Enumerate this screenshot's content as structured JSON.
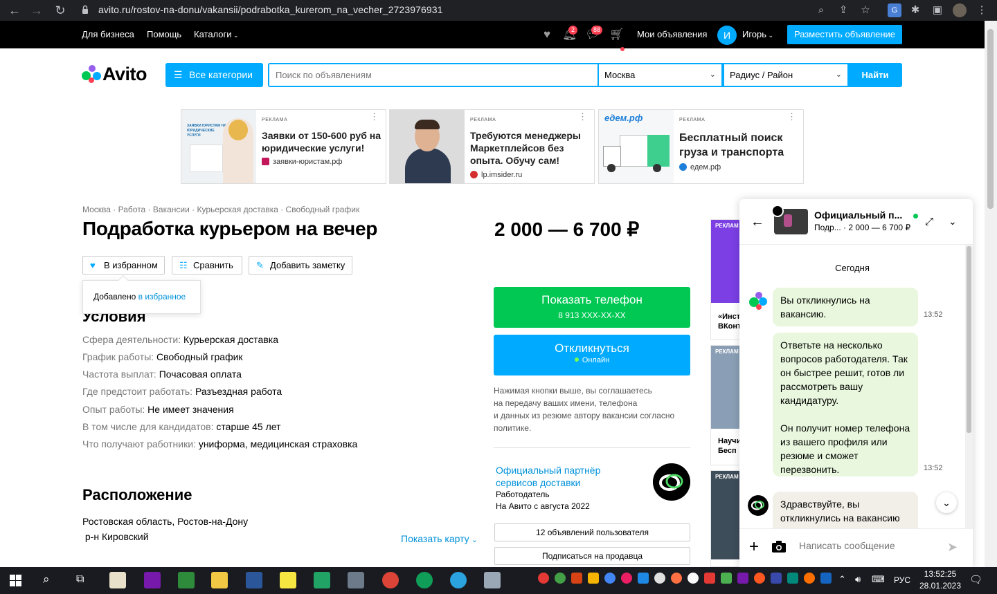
{
  "browser": {
    "url": "avito.ru/rostov-na-donu/vakansii/podrabotka_kurerom_na_vecher_2723976931"
  },
  "topbar": {
    "for_business": "Для бизнеса",
    "help": "Помощь",
    "catalogs": "Каталоги",
    "notifications_count": "2",
    "messages_count": "88",
    "my_ads": "Мои объявления",
    "avatar_letter": "И",
    "user_name": "Игорь",
    "post_ad": "Разместить объявление"
  },
  "search": {
    "logo": "Avito",
    "all_categories": "Все категории",
    "placeholder": "Поиск по объявлениям",
    "city": "Москва",
    "radius": "Радиус / Район",
    "find": "Найти"
  },
  "ads": [
    {
      "tag": "РЕКЛАМА",
      "title": "Заявки от 150-600 руб на юридические услуги!",
      "source": "заявки-юристам.рф"
    },
    {
      "tag": "РЕКЛАМА",
      "title": "Требуются менеджеры Маркетплейсов без опыта. Обучу сам!",
      "source": "lp.imsider.ru"
    },
    {
      "tag": "РЕКЛАМА",
      "title": "Бесплатный поиск груза и транспорта",
      "source": "едем.рф",
      "image_text": "едем.рф"
    }
  ],
  "ad_image_text": {
    "lawyers": "ЗАЯВКИ ЮРИСТАМ НА ЮРИДИЧЕСКИЕ УСЛУГИ"
  },
  "listing": {
    "breadcrumbs": "Москва · Работа · Вакансии · Курьерская доставка · Свободный график",
    "title": "Подработка курьером на вечер",
    "price": "2 000 — 6 700 ₽",
    "favorite": "В избранном",
    "compare": "Сравнить",
    "add_note": "Добавить заметку",
    "tooltip_prefix": "Добавлено ",
    "tooltip_link": "в избранное",
    "conditions_heading": "Условия",
    "conditions": [
      {
        "key": "Сфера деятельности: ",
        "value": "Курьерская доставка"
      },
      {
        "key": "График работы: ",
        "value": "Свободный график"
      },
      {
        "key": "Частота выплат: ",
        "value": "Почасовая оплата"
      },
      {
        "key": "Где предстоит работать: ",
        "value": "Разъездная работа"
      },
      {
        "key": "Опыт работы: ",
        "value": "Не имеет значения"
      },
      {
        "key": "В том числе для кандидатов: ",
        "value": "старше 45 лет"
      },
      {
        "key": "Что получают работники: ",
        "value": "униформа, медицинская страховка"
      }
    ],
    "location_heading": "Расположение",
    "location_line1": "Ростовская область, Ростов-на-Дону",
    "location_line2": "р-н Кировский",
    "show_map": "Показать карту"
  },
  "contact": {
    "show_phone": "Показать телефон",
    "phone_masked": "8 913 XXX-XX-XX",
    "respond": "Откликнуться",
    "online": "Онлайн",
    "disclaimer": [
      "Нажимая кнопки выше, вы соглашаетесь",
      "на передачу ваших имени, телефона",
      "и данных из резюме автору вакансии согласно",
      "политике."
    ],
    "seller_name": "Официальный партнёр сервисов доставки",
    "seller_type": "Работодатель",
    "seller_since": "На Авито с августа 2022",
    "user_ads": "12 объявлений пользователя",
    "subscribe": "Подписаться на продавца"
  },
  "side_ads": [
    {
      "tag": "РЕКЛАМ",
      "text1": "«Инст",
      "text2": "ВКонт"
    },
    {
      "tag": "РЕКЛАМ",
      "text1": "Научи",
      "text2": "Бесп"
    },
    {
      "tag": "РЕКЛАМ",
      "text1": "",
      "text2": ""
    }
  ],
  "chat": {
    "name": "Официальный п...",
    "subtitle": "Подр... · 2 000 — 6 700 ₽",
    "date": "Сегодня",
    "messages": [
      {
        "text": "Вы откликнулись на вакансию.",
        "time": "13:52"
      },
      {
        "text": "Ответьте на несколько вопросов работодателя. Так он быстрее решит, готов ли рассмотреть вашу кандидатуру.\n\nОн получит номер телефона из вашего профиля или резюме и сможет перезвонить.",
        "time": "13:52"
      },
      {
        "text": "Здравствуйте, вы откликнулись на вакансию",
        "time": ""
      }
    ],
    "input_placeholder": "Написать сообщение"
  },
  "taskbar": {
    "lang": "РУС",
    "time": "13:52:25",
    "date": "28.01.2023"
  },
  "colors": {
    "accent": "#00aaff",
    "green": "#00c853",
    "link": "#0091d9"
  }
}
